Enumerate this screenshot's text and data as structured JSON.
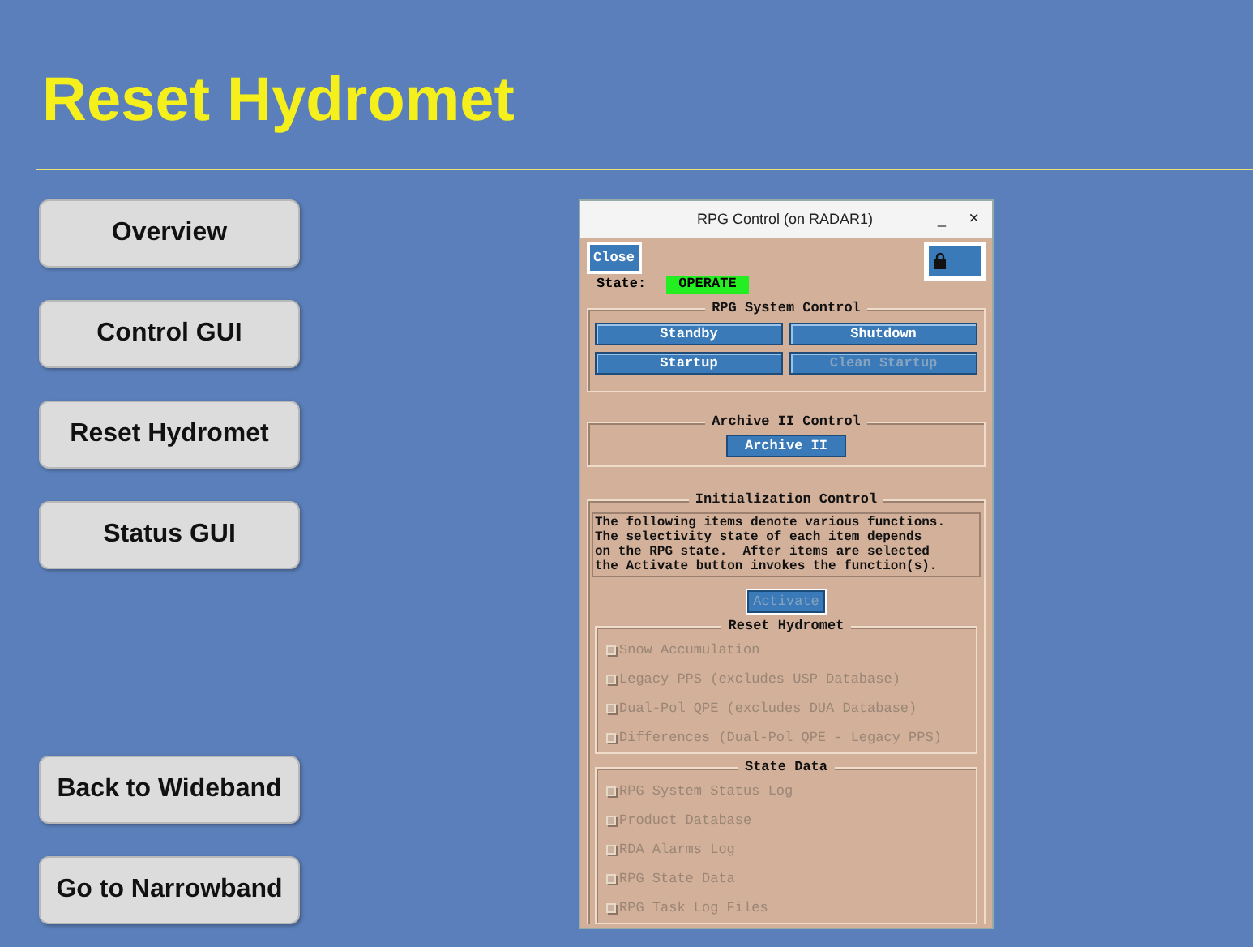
{
  "title": "Reset Hydromet",
  "nav_top": [
    "Overview",
    "Control GUI",
    "Reset Hydromet",
    "Status GUI"
  ],
  "nav_bottom": [
    "Back to Wideband",
    "Go to Narrowband"
  ],
  "dialog": {
    "title": "RPG Control (on RADAR1)",
    "minimize": "_",
    "close_glyph": "×",
    "close_button": "Close",
    "state_label": "State:",
    "state_value": "OPERATE",
    "system_control": {
      "title": "RPG System Control",
      "buttons": [
        {
          "label": "Standby",
          "disabled": false
        },
        {
          "label": "Shutdown",
          "disabled": false
        },
        {
          "label": "Startup",
          "disabled": false
        },
        {
          "label": "Clean Startup",
          "disabled": true
        }
      ]
    },
    "archive": {
      "title": "Archive II Control",
      "button": "Archive II"
    },
    "init": {
      "title": "Initialization Control",
      "text": "The following items denote various functions.\nThe selectivity state of each item depends\non the RPG state.  After items are selected\nthe Activate button invokes the function(s).",
      "activate": "Activate",
      "groups": [
        {
          "title": "Reset Hydromet",
          "items": [
            {
              "label": "Snow Accumulation",
              "checked": false,
              "disabled": true
            },
            {
              "label": "Legacy PPS (excludes USP Database)",
              "checked": false,
              "disabled": true
            },
            {
              "label": "Dual-Pol QPE (excludes DUA Database)",
              "checked": false,
              "disabled": true
            },
            {
              "label": "Differences (Dual-Pol QPE - Legacy PPS)",
              "checked": false,
              "disabled": true
            }
          ]
        },
        {
          "title": "State Data",
          "items": [
            {
              "label": "RPG System Status Log",
              "checked": false,
              "disabled": true
            },
            {
              "label": "Product Database",
              "checked": false,
              "disabled": true
            },
            {
              "label": "RDA Alarms Log",
              "checked": false,
              "disabled": true
            },
            {
              "label": "RPG State Data",
              "checked": false,
              "disabled": true
            },
            {
              "label": "RPG Task Log Files",
              "checked": false,
              "disabled": true
            }
          ]
        }
      ]
    }
  }
}
